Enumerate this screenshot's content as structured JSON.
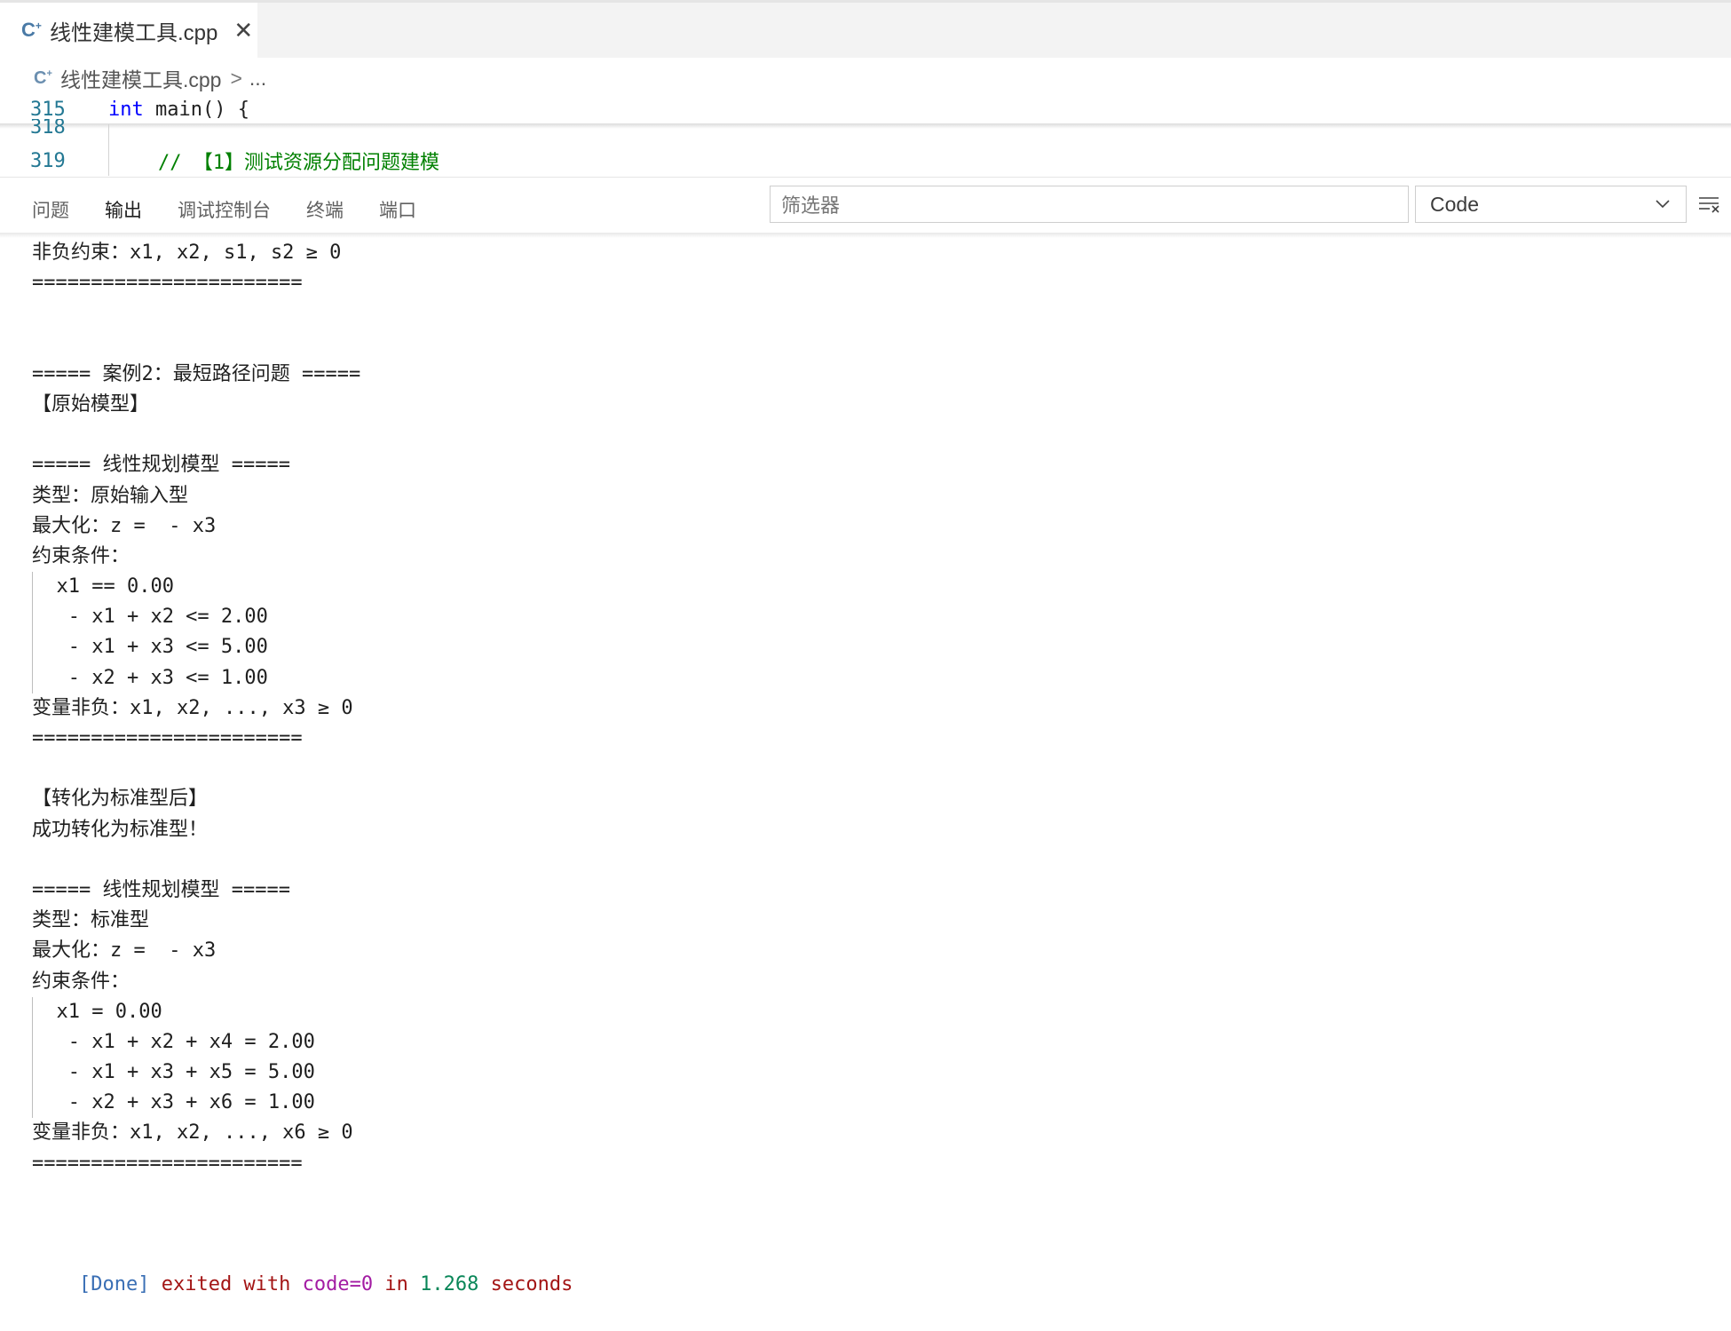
{
  "editor": {
    "tab": {
      "icon": "cpp-file-icon",
      "title": "线性建模工具.cpp",
      "close_glyph": "✕"
    },
    "breadcrumb": {
      "file": "线性建模工具.cpp",
      "separator": ">",
      "ellipsis": "..."
    },
    "sticky_lines": [
      {
        "number": "315",
        "keyword": "int",
        "text": " main() {"
      },
      {
        "number": "318",
        "text": ""
      },
      {
        "number": "319",
        "comment": "// 【1】测试资源分配问题建模"
      }
    ]
  },
  "panel": {
    "tabs": [
      {
        "label": "问题",
        "active": false
      },
      {
        "label": "输出",
        "active": true
      },
      {
        "label": "调试控制台",
        "active": false
      },
      {
        "label": "终端",
        "active": false
      },
      {
        "label": "端口",
        "active": false
      }
    ],
    "filter_placeholder": "筛选器",
    "channel_select": "Code",
    "clear_icon": "clear-output-icon"
  },
  "output": {
    "lines": [
      "非负约束：x1, x2, s1, s2 ≥ 0",
      "=======================",
      "",
      "",
      "===== 案例2：最短路径问题 =====",
      "【原始模型】",
      "",
      "===== 线性规划模型 =====",
      "类型：原始输入型",
      "最大化：z =  - x3",
      "约束条件：",
      "  x1 == 0.00",
      "   - x1 + x2 <= 2.00",
      "   - x1 + x3 <= 5.00",
      "   - x2 + x3 <= 1.00",
      "变量非负：x1, x2, ..., x3 ≥ 0",
      "=======================",
      "",
      "【转化为标准型后】",
      "成功转化为标准型！",
      "",
      "===== 线性规划模型 =====",
      "类型：标准型",
      "最大化：z =  - x3",
      "约束条件：",
      "  x1 = 0.00",
      "   - x1 + x2 + x4 = 2.00",
      "   - x1 + x3 + x5 = 5.00",
      "   - x2 + x3 + x6 = 1.00",
      "变量非负：x1, x2, ..., x6 ≥ 0",
      "=======================",
      "",
      ""
    ],
    "indented_line_indexes": [
      11,
      12,
      13,
      14,
      25,
      26,
      27,
      28
    ],
    "done": {
      "tag": "[Done]",
      "text1": " exited with ",
      "code": "code=0",
      "text2": " in ",
      "time": "1.268",
      "text3": " seconds"
    }
  },
  "colors": {
    "line_number": "#237893",
    "keyword": "#0000ff",
    "comment": "#008000",
    "done_tag": "#3a6fb5",
    "done_text": "#a31515",
    "done_code": "#a31ca3",
    "done_time": "#098658"
  }
}
